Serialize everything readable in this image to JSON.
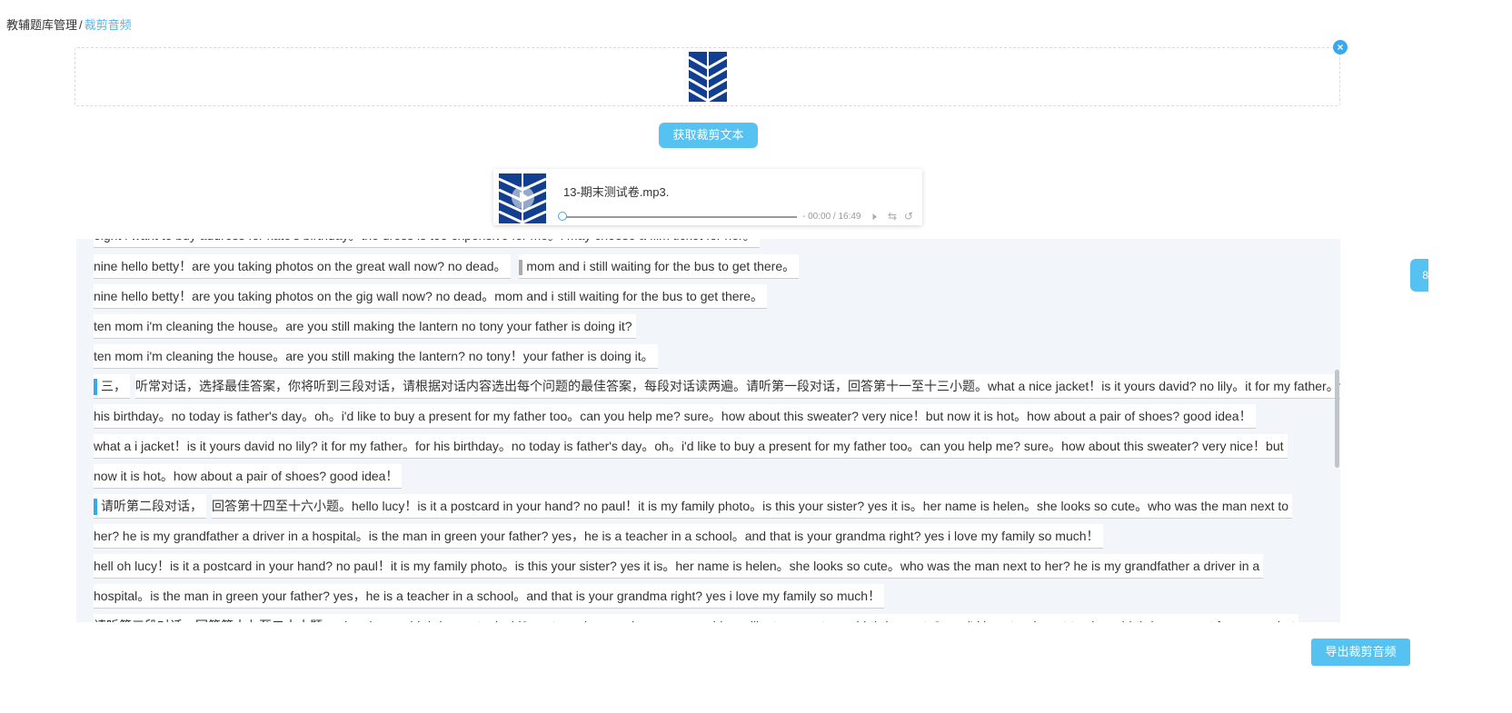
{
  "breadcrumb": {
    "parent": "教辅题库管理",
    "separator": "/",
    "current": "裁剪音频"
  },
  "upload": {
    "close_icon": "close-icon",
    "logo_icon": "brand-chevrons-logo"
  },
  "buttons": {
    "fetch_text": "获取裁剪文本",
    "export_audio": "导出裁剪音频"
  },
  "player": {
    "file_name": "13-期末测试卷.mp3.",
    "time_display": "- 00:00 / 16:49",
    "icons": [
      "play-icon",
      "volume-icon",
      "shuffle-icon",
      "repeat-icon"
    ]
  },
  "side_tab": {
    "label": "8"
  },
  "colors": {
    "accent": "#56c2f2",
    "link": "#4fb6ec",
    "panel": "#f2f6fa",
    "brand_navy": "#123f8f"
  },
  "transcript": {
    "top_partial": "eight i want to buy address for kate's birthday。the dress is too expensive for me。i may choose a film ticket for her。",
    "line1a": "nine hello betty！are you taking photos on the great wall now? no dead。",
    "line1b": "mom and i still waiting for the bus to get there。",
    "line2": "nine hello betty！are you taking photos on the gig wall now? no dead。mom and i still waiting for the bus to get there。",
    "line3": "ten mom i'm cleaning the house。are you still making the lantern no tony your father is doing it?",
    "line4": "ten mom i'm cleaning the house。are you still making the lantern? no tony！your father is doing it。",
    "sec3_head": "三，",
    "sec3_l1": "听常对话，选择最佳答案，你将听到三段对话，请根据对话内容选出每个问题的最佳答案，每段对话读两遍。请听第一段对话，回答第十一至十三小题。what a nice jacket！is it yours david? no lily。it for my father。for",
    "sec3_l2": "his birthday。no today is father's day。oh。i'd like to buy a present for my father too。can you help me? sure。how about this sweater? very nice！but now it is hot。how about a pair of shoes? good idea！",
    "sec3_l3": "what a i jacket！is it yours david no lily? it for my father。for his birthday。no today is father's day。oh。i'd like to buy a present for my father too。can you help me? sure。how about this sweater? very nice！but",
    "sec3_l4": "now it is hot。how about a pair of shoes? good idea！",
    "d2_head": "请听第二段对话，",
    "d2_l1": "回答第十四至十六小题。hello lucy！is it a postcard in your hand? no paul！it is my family photo。is this your sister? yes it is。her name is helen。she looks so cute。who was the man next to",
    "d2_l2": "her? he is my grandfather a driver in a hospital。is the man in green your father? yes，he is a teacher in a school。and that is your grandma right? yes i love my family so much！",
    "d2_l3": "hell oh lucy！is it a postcard in your hand? no paul！it is my family photo。is this your sister? yes it is。her name is helen。she looks so cute。who was the man next to her? he is my grandfather a driver in a",
    "d2_l4": "hospital。is the man in green your father? yes，he is a teacher in a school。and that is your grandma right? yes i love my family so much！",
    "bottom_partial": "请听第三段对话，回答第十七至二十小题。when is your birthday party david? next sunday evening arco。would you like to come to my birthday party? yes i'd love to。i want to give a birthday present for you。what"
  }
}
